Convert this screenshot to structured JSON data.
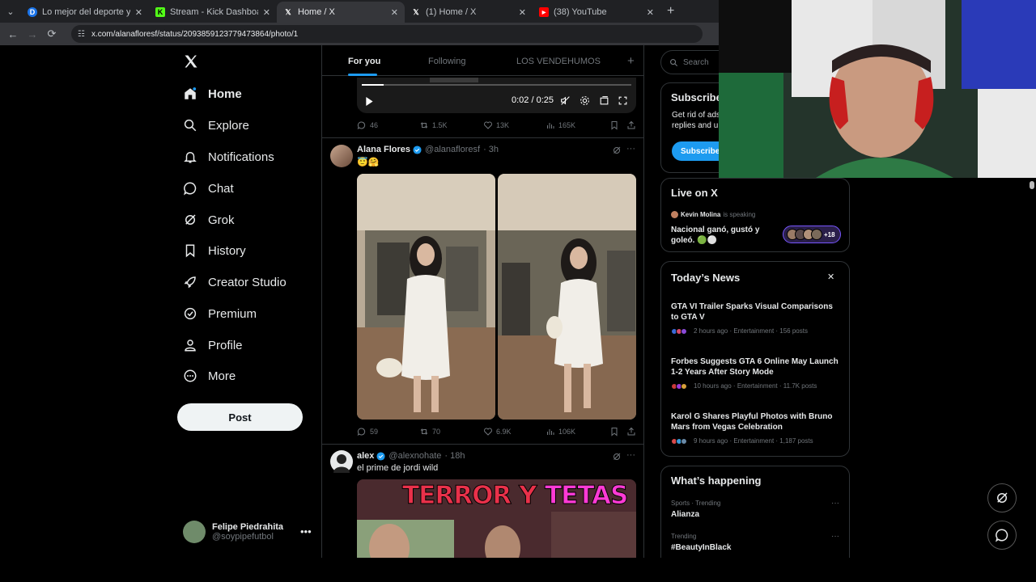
{
  "browser": {
    "tabs": [
      {
        "title": "Lo mejor del deporte y el entre",
        "favicon": "D"
      },
      {
        "title": "Stream - Kick Dashboard",
        "favicon": "K"
      },
      {
        "title": "Home / X",
        "favicon": "X"
      },
      {
        "title": "(1) Home / X",
        "favicon": "X"
      },
      {
        "title": "(38) YouTube",
        "favicon": "YT"
      }
    ],
    "url": "x.com/alanafloresf/status/2093859123779473864/photo/1"
  },
  "sidebar": {
    "items": [
      {
        "label": "Home",
        "icon": "home-icon"
      },
      {
        "label": "Explore",
        "icon": "search-icon"
      },
      {
        "label": "Notifications",
        "icon": "bell-icon"
      },
      {
        "label": "Chat",
        "icon": "chat-icon"
      },
      {
        "label": "Grok",
        "icon": "grok-icon"
      },
      {
        "label": "History",
        "icon": "bookmark-icon"
      },
      {
        "label": "Creator Studio",
        "icon": "rocket-icon"
      },
      {
        "label": "Premium",
        "icon": "verified-icon"
      },
      {
        "label": "Profile",
        "icon": "person-icon"
      },
      {
        "label": "More",
        "icon": "more-circle-icon"
      }
    ],
    "post_label": "Post",
    "account": {
      "name": "Felipe Piedrahita",
      "handle": "@soypipefutbol"
    }
  },
  "feed": {
    "tabs": [
      "For you",
      "Following",
      "LOS VENDEHUMOS"
    ],
    "video": {
      "time": "0:02 / 0:25",
      "progress": 0.08
    },
    "video_actions": {
      "replies": "46",
      "reposts": "1.5K",
      "likes": "13K",
      "views": "165K"
    },
    "tweet1": {
      "name": "Alana Flores",
      "handle": "@alanafloresf",
      "time": "· 3h",
      "text": "😇🤗",
      "actions": {
        "replies": "59",
        "reposts": "70",
        "likes": "6.9K",
        "views": "106K"
      }
    },
    "tweet2": {
      "name": "alex",
      "handle": "@alexnohate",
      "time": "· 18h",
      "text": "el prime de jordi wild",
      "image_text_1": "TERROR Y",
      "image_text_2": "TETAS"
    }
  },
  "right": {
    "search_placeholder": "Search",
    "subscribe": {
      "title": "Subscribe",
      "text1": "Get rid of ads",
      "text2": "replies and u",
      "button": "Subscribe"
    },
    "live": {
      "title": "Live on X",
      "host": "Kevin Molina",
      "status": "is speaking",
      "topic": "Nacional ganó, gustó y goleó. 🟢⚪",
      "count": "+18"
    },
    "news": {
      "title": "Today’s News",
      "items": [
        {
          "title": "GTA VI Trailer Sparks Visual Comparisons to GTA V",
          "meta": "2 hours ago · Entertainment · 156 posts"
        },
        {
          "title": "Forbes Suggests GTA 6 Online May Launch 1-2 Years After Story Mode",
          "meta": "10 hours ago · Entertainment · 11.7K posts"
        },
        {
          "title": "Karol G Shares Playful Photos with Bruno Mars from Vegas Celebration",
          "meta": "9 hours ago · Entertainment · 1,187 posts"
        }
      ]
    },
    "happening": {
      "title": "What’s happening",
      "items": [
        {
          "context": "Sports · Trending",
          "topic": "Alianza"
        },
        {
          "context": "Trending",
          "topic": "#BeautyInBlack"
        }
      ]
    }
  },
  "colors": {
    "accent": "#1d9bf0",
    "background": "#000000",
    "border": "#2f3336",
    "muted": "#71767b"
  }
}
